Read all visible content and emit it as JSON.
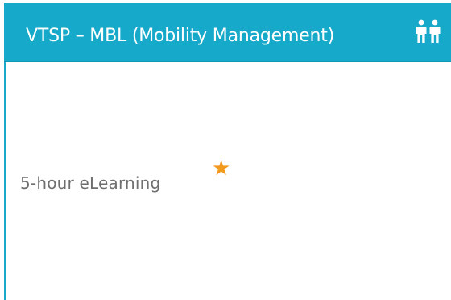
{
  "card": {
    "title": "VTSP – MBL (Mobility Management)",
    "header_icon": "people-icon",
    "format_label": "5-hour eLearning",
    "badge_icon": "star-icon",
    "badge_glyph": "★",
    "colors": {
      "header": "#17a9c9",
      "star": "#f39a1e",
      "body_text": "#6f6f6f"
    }
  }
}
